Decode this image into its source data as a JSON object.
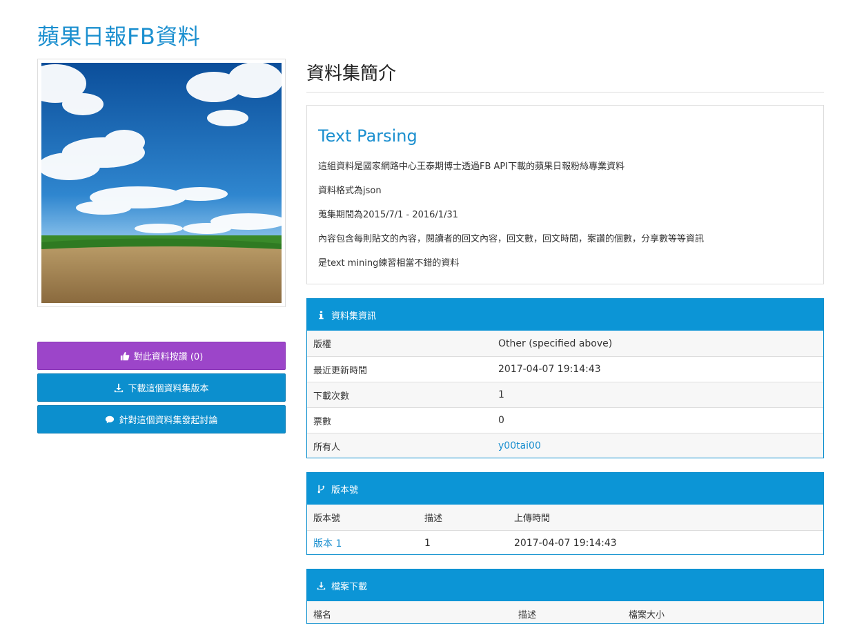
{
  "page": {
    "title": "蘋果日報FB資料"
  },
  "left": {
    "like_button": "對此資料按讚 (0)",
    "download_button": "下載這個資料集版本",
    "discuss_button": "針對這個資料集發起討論"
  },
  "intro": {
    "section_title": "資料集簡介",
    "heading": "Text Parsing",
    "lines": [
      "這組資料是國家網路中心王泰期博士透過FB API下載的蘋果日報粉絲專業資料",
      "資料格式為json",
      "蒐集期間為2015/7/1 - 2016/1/31",
      "內容包含每則貼文的內容，閱讀者的回文內容，回文數，回文時間，案讚的個數，分享數等等資訊",
      "是text mining練習相當不錯的資料"
    ]
  },
  "info": {
    "header": "資料集資訊",
    "rows": [
      {
        "key": "版權",
        "value": "Other (specified above)"
      },
      {
        "key": "最近更新時間",
        "value": "2017-04-07 19:14:43"
      },
      {
        "key": "下載次數",
        "value": "1"
      },
      {
        "key": "票數",
        "value": "0"
      },
      {
        "key": "所有人",
        "value": "y00tai00"
      }
    ]
  },
  "versions": {
    "header": "版本號",
    "columns": [
      "版本號",
      "描述",
      "上傳時間"
    ],
    "rows": [
      {
        "version": "版本 1",
        "desc": "1",
        "time": "2017-04-07 19:14:43"
      }
    ]
  },
  "files": {
    "header": "檔案下載",
    "columns": [
      "檔名",
      "描述",
      "檔案大小"
    ]
  },
  "colors": {
    "accent": "#0c95d6",
    "like": "#9c45c9",
    "title": "#1b8fcf"
  }
}
